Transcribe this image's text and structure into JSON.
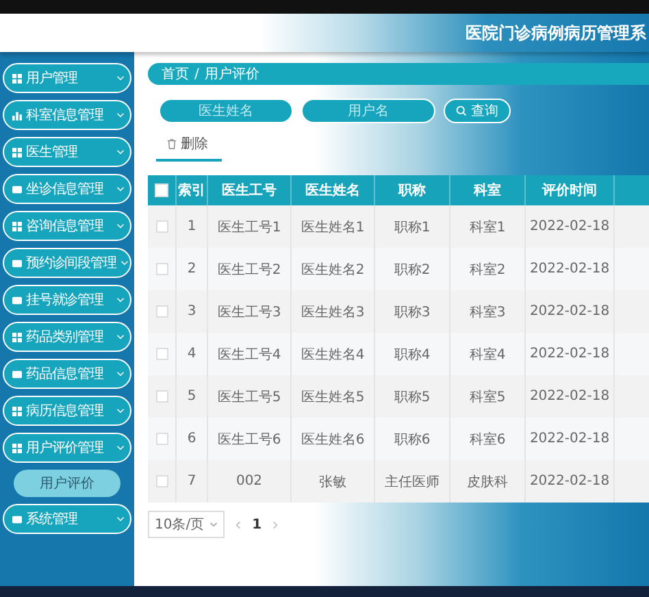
{
  "header": {
    "title": "医院门诊病例病历管理系"
  },
  "sidebar": {
    "items": [
      {
        "label": "用户管理"
      },
      {
        "label": "科室信息管理"
      },
      {
        "label": "医生管理"
      },
      {
        "label": "坐诊信息管理"
      },
      {
        "label": "咨询信息管理"
      },
      {
        "label": "预约诊间段管理"
      },
      {
        "label": "挂号就诊管理"
      },
      {
        "label": "药品类别管理"
      },
      {
        "label": "药品信息管理"
      },
      {
        "label": "病历信息管理"
      },
      {
        "label": "用户评价管理",
        "children": [
          {
            "label": "用户评价",
            "selected": true
          }
        ]
      },
      {
        "label": "系统管理"
      }
    ]
  },
  "breadcrumb": {
    "items": [
      "首页",
      "用户评价"
    ],
    "separator": "/"
  },
  "search": {
    "fields": [
      {
        "placeholder": "医生姓名"
      },
      {
        "placeholder": "用户名"
      }
    ],
    "button": "查询"
  },
  "toolbar": {
    "delete_button": "删除"
  },
  "table": {
    "header_checked": false,
    "columns": [
      "索引",
      "医生工号",
      "医生姓名",
      "职称",
      "科室",
      "评价时间"
    ],
    "rows": [
      {
        "checked": false,
        "cells": [
          "1",
          "医生工号1",
          "医生姓名1",
          "职称1",
          "科室1",
          "2022-02-18"
        ]
      },
      {
        "checked": false,
        "cells": [
          "2",
          "医生工号2",
          "医生姓名2",
          "职称2",
          "科室2",
          "2022-02-18"
        ]
      },
      {
        "checked": false,
        "cells": [
          "3",
          "医生工号3",
          "医生姓名3",
          "职称3",
          "科室3",
          "2022-02-18"
        ]
      },
      {
        "checked": false,
        "cells": [
          "4",
          "医生工号4",
          "医生姓名4",
          "职称4",
          "科室4",
          "2022-02-18"
        ]
      },
      {
        "checked": false,
        "cells": [
          "5",
          "医生工号5",
          "医生姓名5",
          "职称5",
          "科室5",
          "2022-02-18"
        ]
      },
      {
        "checked": false,
        "cells": [
          "6",
          "医生工号6",
          "医生姓名6",
          "职称6",
          "科室6",
          "2022-02-18"
        ]
      },
      {
        "checked": false,
        "cells": [
          "7",
          "002",
          "张敏",
          "主任医师",
          "皮肤科",
          "2022-02-18"
        ]
      }
    ]
  },
  "pagination": {
    "page_size": "10条/页",
    "current_page": "1"
  }
}
